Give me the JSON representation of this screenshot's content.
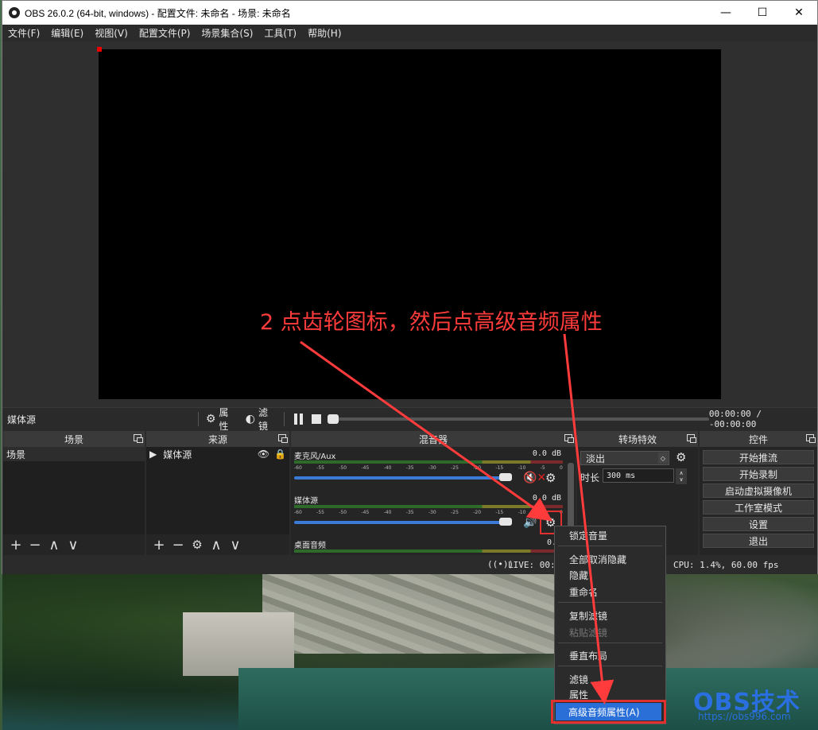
{
  "window": {
    "title": "OBS 26.0.2 (64-bit, windows) - 配置文件: 未命名 - 场景: 未命名",
    "minimize": "—",
    "maximize": "☐",
    "close": "✕"
  },
  "menu": [
    "文件(F)",
    "编辑(E)",
    "视图(V)",
    "配置文件(P)",
    "场景集合(S)",
    "工具(T)",
    "帮助(H)"
  ],
  "source_toolbar": {
    "source_name": "媒体源",
    "properties": "属性",
    "filters": "滤镜",
    "time": "00:00:00 / -00:00:00",
    "seek_progress": 0.0
  },
  "docks": {
    "scenes": {
      "title": "场景",
      "items": [
        "场景"
      ]
    },
    "sources": {
      "title": "来源",
      "items": [
        "媒体源"
      ]
    },
    "mixer": {
      "title": "混音器",
      "channels": [
        {
          "name": "麦克风/Aux",
          "db": "0.0 dB",
          "muted": true,
          "volume": 1.0
        },
        {
          "name": "媒体源",
          "db": "0.0 dB",
          "muted": false,
          "volume": 1.0
        },
        {
          "name": "桌面音频",
          "db": "0.0",
          "muted": false,
          "volume": 1.0
        }
      ],
      "ticks": [
        "-60",
        "-55",
        "-50",
        "-45",
        "-40",
        "-35",
        "-30",
        "-25",
        "-20",
        "-15",
        "-10",
        "-5",
        "0"
      ]
    },
    "transitions": {
      "title": "转场特效",
      "selected": "淡出",
      "duration_label": "时长",
      "duration_value": "300 ms"
    },
    "controls": {
      "title": "控件",
      "buttons": [
        "开始推流",
        "开始录制",
        "启动虚拟摄像机",
        "工作室模式",
        "设置",
        "退出"
      ]
    }
  },
  "status": {
    "live": "LIVE: 00:0",
    "cpu": "CPU: 1.4%, 60.00 fps"
  },
  "context_menu": {
    "items": [
      "锁定音量",
      "全部取消隐藏",
      "隐藏",
      "重命名",
      "复制滤镜",
      "粘贴滤镜",
      "垂直布局",
      "滤镜",
      "属性",
      "高级音频属性(A)"
    ]
  },
  "annotation": "2 点齿轮图标，然后点高级音频属性",
  "watermark": {
    "logo": "OBS技术",
    "url": "https://obs996.com"
  },
  "colors": {
    "annotation": "#ff3b3b",
    "highlight": "#2a6fd8",
    "slider": "#3b7ad6"
  }
}
